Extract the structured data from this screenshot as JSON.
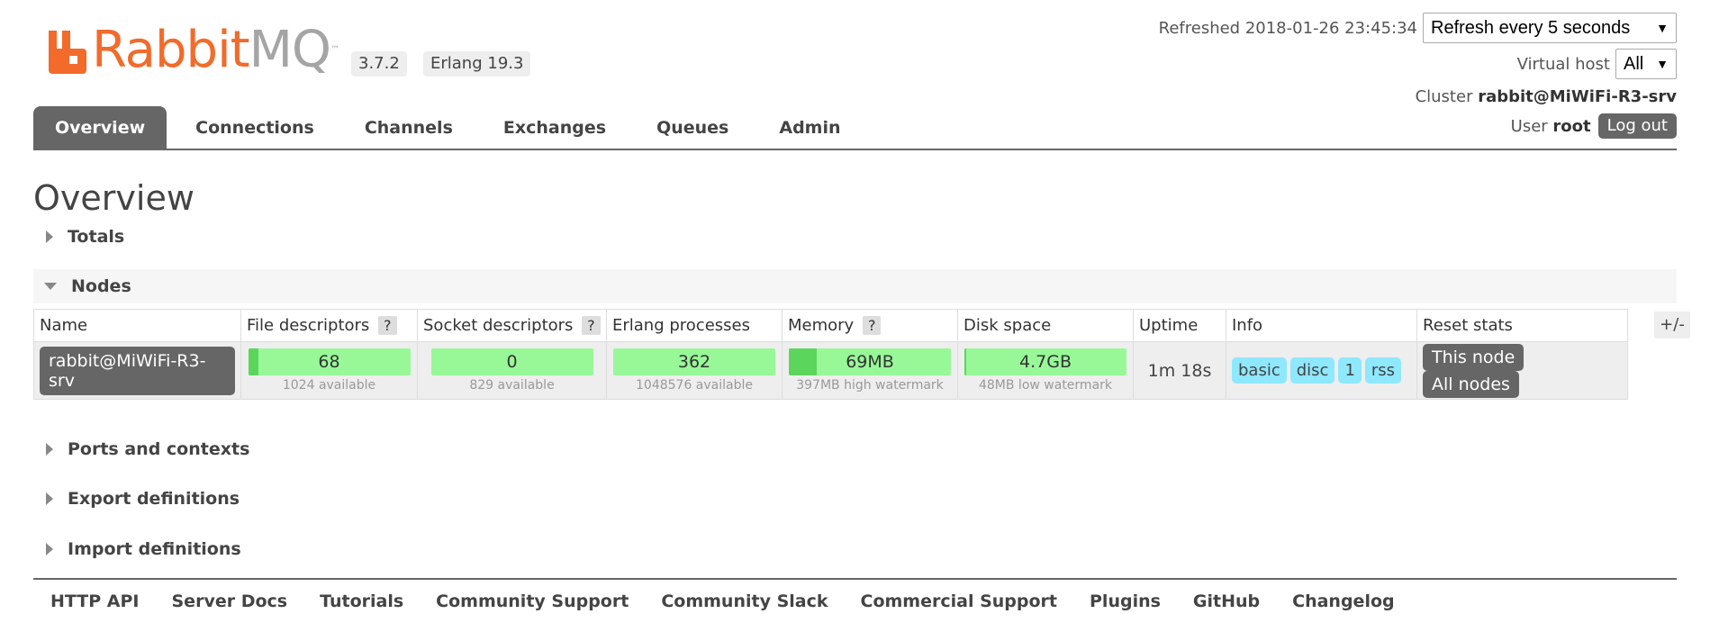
{
  "brand": {
    "name_part1": "Rabbit",
    "name_part2": "MQ",
    "tm": "™",
    "primary_color": "#f26b2b",
    "secondary_color": "#a5a5a5"
  },
  "versions": {
    "rabbitmq": "3.7.2",
    "erlang": "Erlang 19.3"
  },
  "header": {
    "refreshed_text": "Refreshed 2018-01-26 23:45:34",
    "refresh_select": "Refresh every 5 seconds",
    "vhost_label": "Virtual host",
    "vhost_select": "All",
    "cluster_label": "Cluster",
    "cluster_name": "rabbit@MiWiFi-R3-srv",
    "user_label": "User",
    "user_name": "root",
    "logout_label": "Log out"
  },
  "tabs": [
    {
      "label": "Overview",
      "active": true
    },
    {
      "label": "Connections"
    },
    {
      "label": "Channels"
    },
    {
      "label": "Exchanges"
    },
    {
      "label": "Queues"
    },
    {
      "label": "Admin"
    }
  ],
  "page_title": "Overview",
  "sections": {
    "totals": "Totals",
    "nodes": "Nodes",
    "ports": "Ports and contexts",
    "export": "Export definitions",
    "import": "Import definitions"
  },
  "nodes_table": {
    "headers": {
      "name": "Name",
      "file_desc": "File descriptors",
      "socket_desc": "Socket descriptors",
      "erlang_proc": "Erlang processes",
      "memory": "Memory",
      "disk": "Disk space",
      "uptime": "Uptime",
      "info": "Info",
      "reset": "Reset stats"
    },
    "help_glyph": "?",
    "toggle_columns": "+/-",
    "row": {
      "name": "rabbit@MiWiFi-R3-srv",
      "file_desc": {
        "value": "68",
        "sub": "1024 available",
        "fill_fraction": 0.066
      },
      "socket_desc": {
        "value": "0",
        "sub": "829 available",
        "fill_fraction": 0.0
      },
      "erlang_proc": {
        "value": "362",
        "sub": "1048576 available",
        "fill_fraction": 0.0003
      },
      "memory": {
        "value": "69MB",
        "sub": "397MB high watermark",
        "fill_fraction": 0.174
      },
      "disk": {
        "value": "4.7GB",
        "sub": "48MB low watermark",
        "fill_fraction": 0.01
      },
      "uptime": "1m 18s",
      "info_tags": [
        "basic",
        "disc",
        "1",
        "rss"
      ],
      "reset_this": "This node",
      "reset_all": "All nodes"
    }
  },
  "footer_links": [
    "HTTP API",
    "Server Docs",
    "Tutorials",
    "Community Support",
    "Community Slack",
    "Commercial Support",
    "Plugins",
    "GitHub",
    "Changelog"
  ]
}
